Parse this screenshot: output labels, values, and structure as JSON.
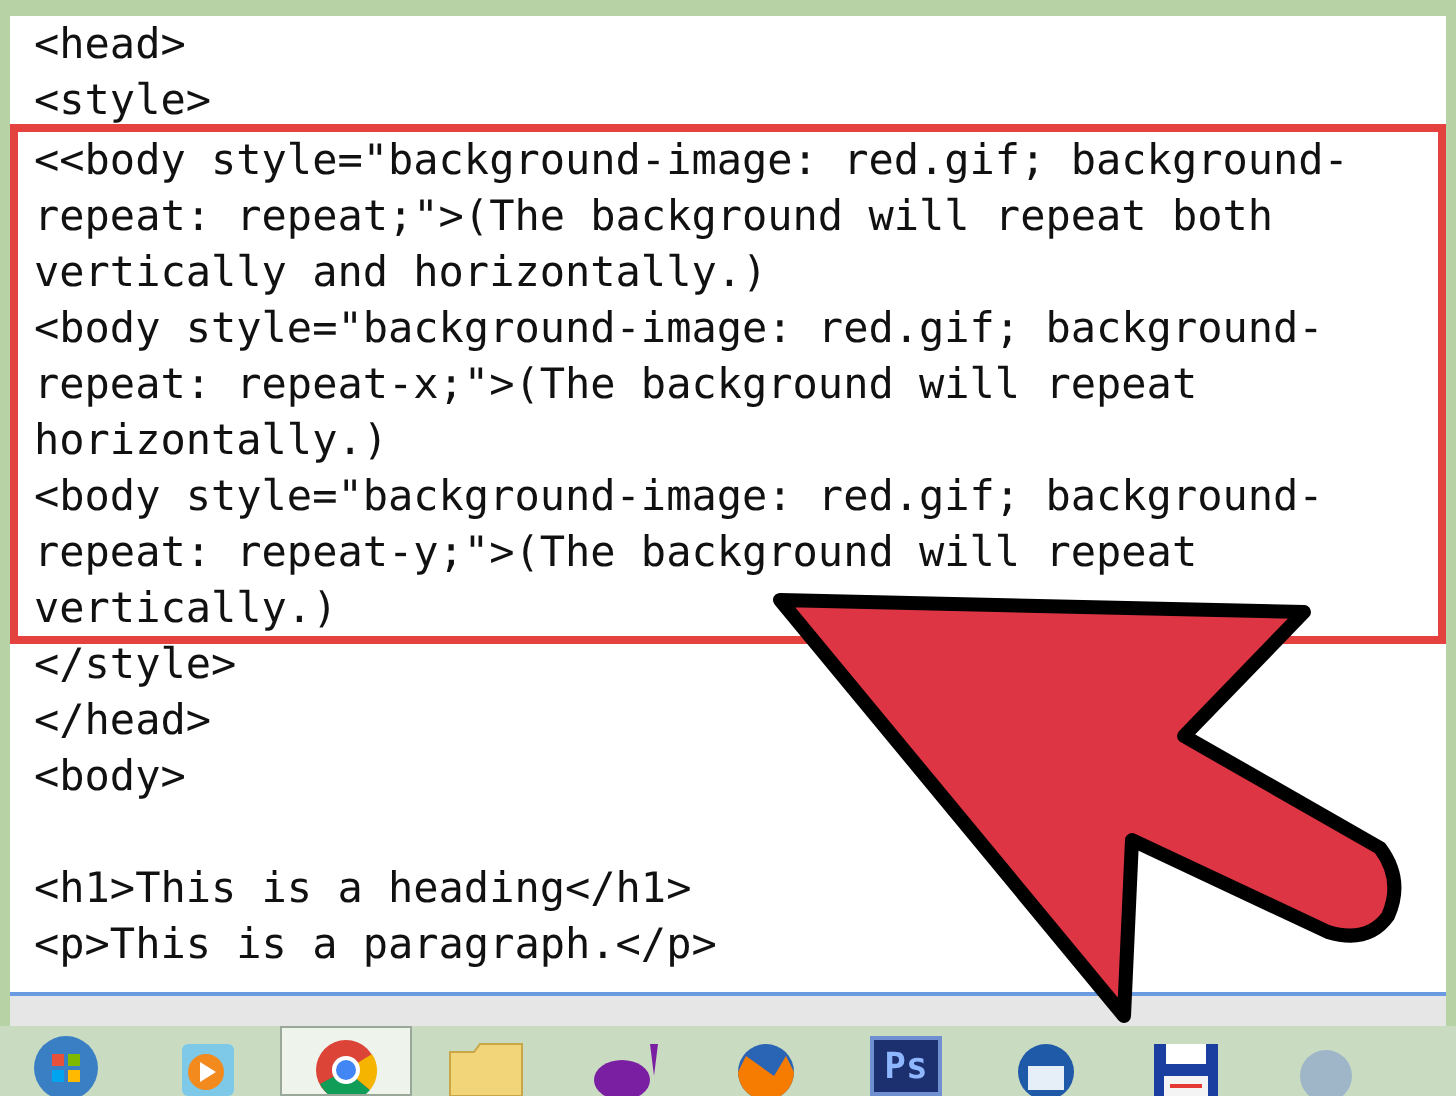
{
  "editor": {
    "lines_before": [
      {
        "kind": "code",
        "text": "<head>"
      },
      {
        "kind": "code",
        "text": "<style>"
      }
    ],
    "highlight_box": {
      "lines": [
        {
          "kind": "code",
          "text": "<<body style=\"background-image: red.gif; background-repeat: repeat;\">(The background will repeat both vertically and horizontally.)"
        },
        {
          "kind": "code",
          "text": "<body style=\"background-image: red.gif; background-repeat: repeat-x;\">(The background will repeat horizontally.)"
        },
        {
          "kind": "code",
          "text": "<body style=\"background-image: red.gif; background-repeat: repeat-y;\">(The background will repeat vertically.)"
        }
      ]
    },
    "lines_after": [
      {
        "kind": "code",
        "text": "</style>"
      },
      {
        "kind": "code",
        "text": "</head>"
      },
      {
        "kind": "code",
        "text": "<body>"
      },
      {
        "kind": "blank"
      },
      {
        "kind": "code",
        "text": "<h1>This is a heading</h1>"
      },
      {
        "kind": "code",
        "text": "<p>This is a paragraph.</p>"
      }
    ]
  },
  "taskbar": {
    "items": [
      {
        "kind": "start",
        "selected": false
      },
      {
        "kind": "media",
        "selected": false
      },
      {
        "kind": "browser",
        "selected": true
      },
      {
        "kind": "folder",
        "selected": false
      },
      {
        "kind": "mail",
        "selected": false
      },
      {
        "kind": "fox",
        "selected": false
      },
      {
        "kind": "ps",
        "label": "Ps",
        "selected": false
      },
      {
        "kind": "bird",
        "selected": false
      },
      {
        "kind": "disk",
        "selected": false
      },
      {
        "kind": "globe",
        "selected": false
      }
    ]
  }
}
